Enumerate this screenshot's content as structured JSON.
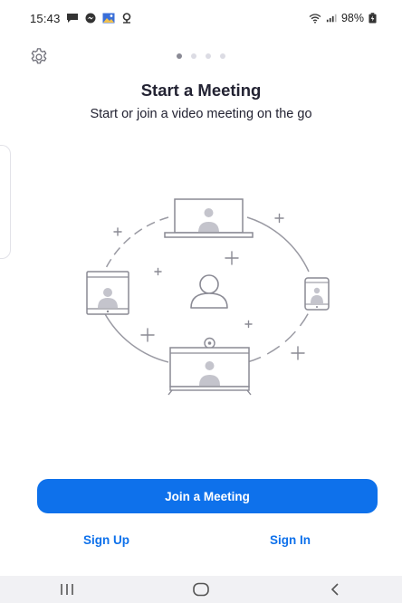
{
  "status_bar": {
    "time": "15:43",
    "battery": "98%",
    "notification_icons": [
      "chat-icon",
      "messenger-icon",
      "gallery-icon",
      "location-icon"
    ],
    "right_icons": [
      "wifi-icon",
      "signal-icon",
      "battery-icon"
    ]
  },
  "header": {
    "settings_icon": "gear-icon",
    "page_indicator": {
      "count": 4,
      "active": 1
    }
  },
  "main": {
    "title": "Start a Meeting",
    "subtitle": "Start or join a video meeting on the go",
    "illustration": "devices-meeting-illustration"
  },
  "actions": {
    "join_label": "Join a Meeting",
    "sign_up_label": "Sign Up",
    "sign_in_label": "Sign In"
  },
  "nav_bar": {
    "items": [
      "recents-icon",
      "home-icon",
      "back-icon"
    ]
  },
  "colors": {
    "accent": "#0e71eb",
    "text": "#232333",
    "line": "#9a9aa3",
    "person": "#c4c4cc",
    "nav_bg": "#f1f1f4"
  }
}
